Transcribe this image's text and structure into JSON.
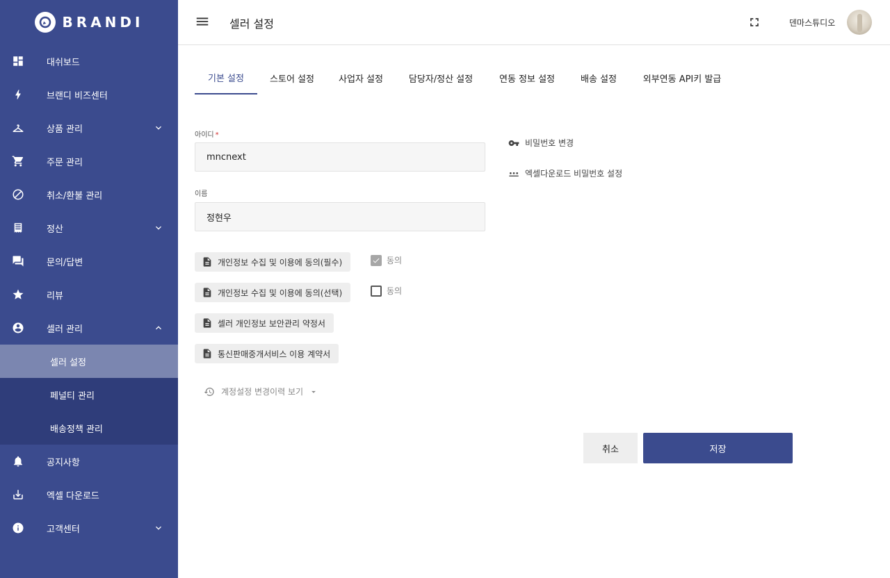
{
  "brand": {
    "name": "BRANDI",
    "accent": "#3b4b8e"
  },
  "sidebar": {
    "items": [
      {
        "label": "대쉬보드",
        "icon": "dashboard-icon"
      },
      {
        "label": "브랜디 비즈센터",
        "icon": "bolt-icon"
      },
      {
        "label": "상품 관리",
        "icon": "hanger-icon",
        "expand": "chevron-down-icon"
      },
      {
        "label": "주문 관리",
        "icon": "cart-icon"
      },
      {
        "label": "취소/환불 관리",
        "icon": "block-icon"
      },
      {
        "label": "정산",
        "icon": "receipt-icon",
        "expand": "chevron-down-icon"
      },
      {
        "label": "문의/답변",
        "icon": "forum-icon"
      },
      {
        "label": "리뷰",
        "icon": "star-icon"
      },
      {
        "label": "셀러 관리",
        "icon": "account-circle-icon",
        "expand": "chevron-up-icon"
      }
    ],
    "seller_submenu": [
      {
        "label": "셀러 설정",
        "active": true
      },
      {
        "label": "페널티 관리"
      },
      {
        "label": "배송정책 관리"
      }
    ],
    "bottom_items": [
      {
        "label": "공지사항",
        "icon": "bell-icon"
      },
      {
        "label": "엑셀 다운로드",
        "icon": "download-icon"
      },
      {
        "label": "고객센터",
        "icon": "info-icon",
        "expand": "chevron-down-icon"
      }
    ]
  },
  "header": {
    "title": "셀러 설정",
    "username": "덴마스튜디오"
  },
  "tabs": [
    {
      "label": "기본 설정",
      "active": true
    },
    {
      "label": "스토어 설정"
    },
    {
      "label": "사업자 설정"
    },
    {
      "label": "담당자/정산 설정"
    },
    {
      "label": "연동 정보 설정"
    },
    {
      "label": "배송 설정"
    },
    {
      "label": "외부연동 API키 발급"
    }
  ],
  "form": {
    "id_label": "아이디",
    "id_required_mark": "*",
    "id_value": "mncnext",
    "name_label": "이름",
    "name_value": "정현우"
  },
  "side_links": {
    "change_password": "비밀번호 변경",
    "excel_password": "엑셀다운로드 비밀번호 설정"
  },
  "documents": [
    {
      "label": "개인정보 수집 및 이용에 동의(필수)",
      "agree_label": "동의",
      "checked": true
    },
    {
      "label": "개인정보 수집 및 이용에 동의(선택)",
      "agree_label": "동의",
      "checked": false
    },
    {
      "label": "셀러 개인정보 보안관리 약정서"
    },
    {
      "label": "통신판매중개서비스 이용 계약서"
    }
  ],
  "history": {
    "label": "계정설정 변경이력 보기"
  },
  "actions": {
    "cancel": "취소",
    "save": "저장"
  }
}
